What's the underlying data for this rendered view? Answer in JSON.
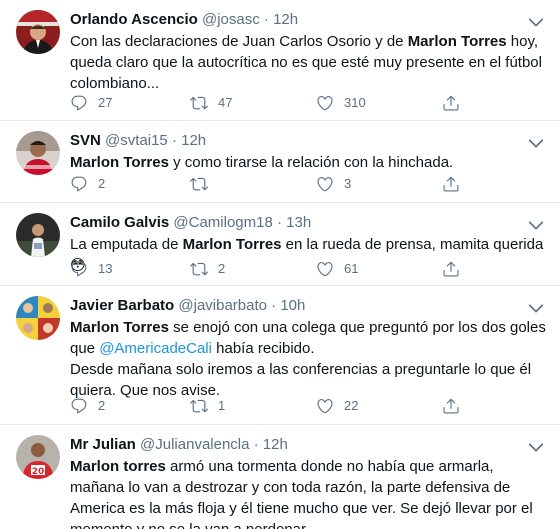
{
  "tweets": [
    {
      "name": "Orlando Ascencio",
      "handle": "@josasc",
      "separator": "·",
      "time": "12h",
      "text_1": "Con las declaraciones de Juan Carlos Osorio y de ",
      "text_bold": "Marlon Torres",
      "text_2": " hoy, queda claro que la autocrítica no es que esté muy presente en el fútbol colombiano...",
      "replies": "27",
      "retweets": "47",
      "likes": "310"
    },
    {
      "name": "SVN",
      "handle": "@svtai15",
      "separator": "·",
      "time": "12h",
      "text_bold": "Marlon Torres",
      "text_2": " y como tirarse la relación con la hinchada.",
      "replies": "2",
      "retweets": "",
      "likes": "3"
    },
    {
      "name": "Camilo Galvis",
      "handle": "@Camilogm18",
      "separator": "·",
      "time": "13h",
      "text_1": "La emputada de ",
      "text_bold": "Marlon Torres",
      "text_2": " en la rueda de prensa, mamita querida ",
      "emoji": "😳",
      "replies": "13",
      "retweets": "2",
      "likes": "61"
    },
    {
      "name": "Javier Barbato",
      "handle": "@javibarbato",
      "separator": "·",
      "time": "10h",
      "text_bold": "Marlon Torres",
      "text_2": " se enojó con una colega que preguntó por los dos goles que ",
      "mention": "@AmericadeCali",
      "text_3": " había recibido.",
      "text_4": "Desde mañana solo iremos a las conferencias a preguntarle lo que él quiera. Que nos avise.",
      "replies": "2",
      "retweets": "1",
      "likes": "22"
    },
    {
      "name": "Mr Julian",
      "handle": "@Julianvalencla",
      "separator": "·",
      "time": "12h",
      "text_bold": "Marlon torres",
      "text_2": " armó una tormenta donde no había que armarla, mañana lo van a destrozar y con toda razón, la parte defensiva de America es la más floja y él tiene mucho que ver. Se dejó llevar por el momento y no se la van a perdonar."
    }
  ]
}
